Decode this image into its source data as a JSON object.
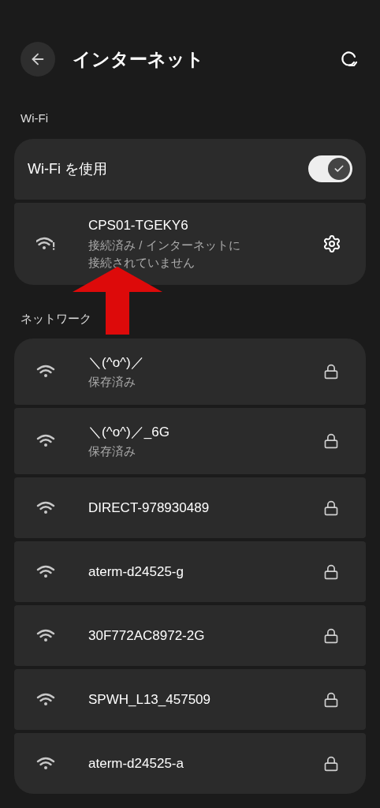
{
  "header": {
    "title": "インターネット"
  },
  "wifi_section": {
    "label": "Wi-Fi"
  },
  "wifi_toggle": {
    "label": "Wi-Fi を使用",
    "on": true
  },
  "connected_network": {
    "name": "CPS01-TGEKY6",
    "status": "接続済み / インターネットに接続されていません"
  },
  "annotation": {
    "kind": "arrow"
  },
  "networks_section": {
    "label": "ネットワーク"
  },
  "networks": [
    {
      "name": "＼(^o^)／",
      "status": "保存済み",
      "locked": true
    },
    {
      "name": "＼(^o^)／_6G",
      "status": "保存済み",
      "locked": true
    },
    {
      "name": "DIRECT-978930489",
      "locked": true
    },
    {
      "name": "aterm-d24525-g",
      "locked": true
    },
    {
      "name": "30F772AC8972-2G",
      "locked": true
    },
    {
      "name": "SPWH_L13_457509",
      "locked": true
    },
    {
      "name": "aterm-d24525-a",
      "locked": true
    }
  ]
}
